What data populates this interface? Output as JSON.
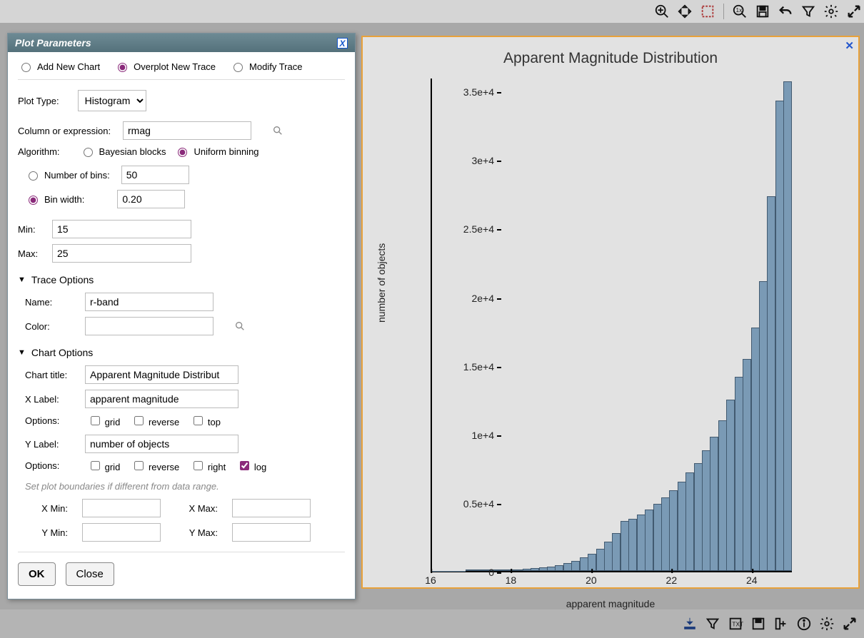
{
  "dialog": {
    "title": "Plot Parameters",
    "mode_group": {
      "add": "Add New Chart",
      "overplot": "Overplot New Trace",
      "modify": "Modify Trace",
      "selected": "overplot"
    },
    "plot_type_label": "Plot Type:",
    "plot_type_value": "Histogram",
    "column_label": "Column or expression:",
    "column_value": "rmag",
    "algorithm_label": "Algorithm:",
    "algo_bayesian": "Bayesian blocks",
    "algo_uniform": "Uniform binning",
    "algo_selected": "uniform",
    "bins_mode_selected": "width",
    "numbins_label": "Number of bins:",
    "numbins_value": "50",
    "binwidth_label": "Bin width:",
    "binwidth_value": "0.20",
    "min_label": "Min:",
    "min_value": "15",
    "max_label": "Max:",
    "max_value": "25",
    "trace_options_label": "Trace Options",
    "name_label": "Name:",
    "name_value": "r-band",
    "color_label": "Color:",
    "color_value": "",
    "chart_options_label": "Chart Options",
    "chart_title_label": "Chart title:",
    "chart_title_value": "Apparent Magnitude Distribut",
    "xlabel_label": "X Label:",
    "xlabel_value": "apparent magnitude",
    "options_label": "Options:",
    "x_grid": "grid",
    "x_reverse": "reverse",
    "x_top": "top",
    "ylabel_label": "Y Label:",
    "ylabel_value": "number of objects",
    "y_grid": "grid",
    "y_reverse": "reverse",
    "y_right": "right",
    "y_log": "log",
    "y_log_checked": true,
    "boundaries_note": "Set plot boundaries if different from data range.",
    "xmin_label": "X Min:",
    "xmax_label": "X Max:",
    "ymin_label": "Y Min:",
    "ymax_label": "Y Max:",
    "xmin_value": "",
    "xmax_value": "",
    "ymin_value": "",
    "ymax_value": "",
    "ok": "OK",
    "close": "Close"
  },
  "chart_data": {
    "type": "bar",
    "title": "Apparent Magnitude Distribution",
    "xlabel": "apparent magnitude",
    "ylabel": "number of objects",
    "xlim": [
      16,
      25
    ],
    "ylim": [
      0,
      36000
    ],
    "x_ticks": [
      16,
      18,
      20,
      22,
      24
    ],
    "y_ticks": [
      "0",
      "0.5e+4",
      "1e+4",
      "1.5e+4",
      "2e+4",
      "2.5e+4",
      "3e+4",
      "3.5e+4"
    ],
    "categories": [
      16.0,
      16.2,
      16.4,
      16.6,
      16.8,
      17.0,
      17.2,
      17.4,
      17.6,
      17.8,
      18.0,
      18.2,
      18.4,
      18.6,
      18.8,
      19.0,
      19.2,
      19.4,
      19.6,
      19.8,
      20.0,
      20.2,
      20.4,
      20.6,
      20.8,
      21.0,
      21.2,
      21.4,
      21.6,
      21.8,
      22.0,
      22.2,
      22.4,
      22.6,
      22.8,
      23.0,
      23.2,
      23.4,
      23.6,
      23.8,
      24.0,
      24.2,
      24.4,
      24.6,
      24.8
    ],
    "values": [
      5,
      7,
      10,
      13,
      17,
      23,
      30,
      40,
      52,
      68,
      89,
      116,
      151,
      197,
      257,
      335,
      436,
      569,
      742,
      967,
      1260,
      1643,
      2142,
      2792,
      3639,
      3800,
      4100,
      4500,
      4900,
      5400,
      5900,
      6500,
      7200,
      7900,
      8800,
      9800,
      11000,
      12500,
      14200,
      15500,
      17800,
      21200,
      27400,
      34400,
      35800
    ]
  }
}
